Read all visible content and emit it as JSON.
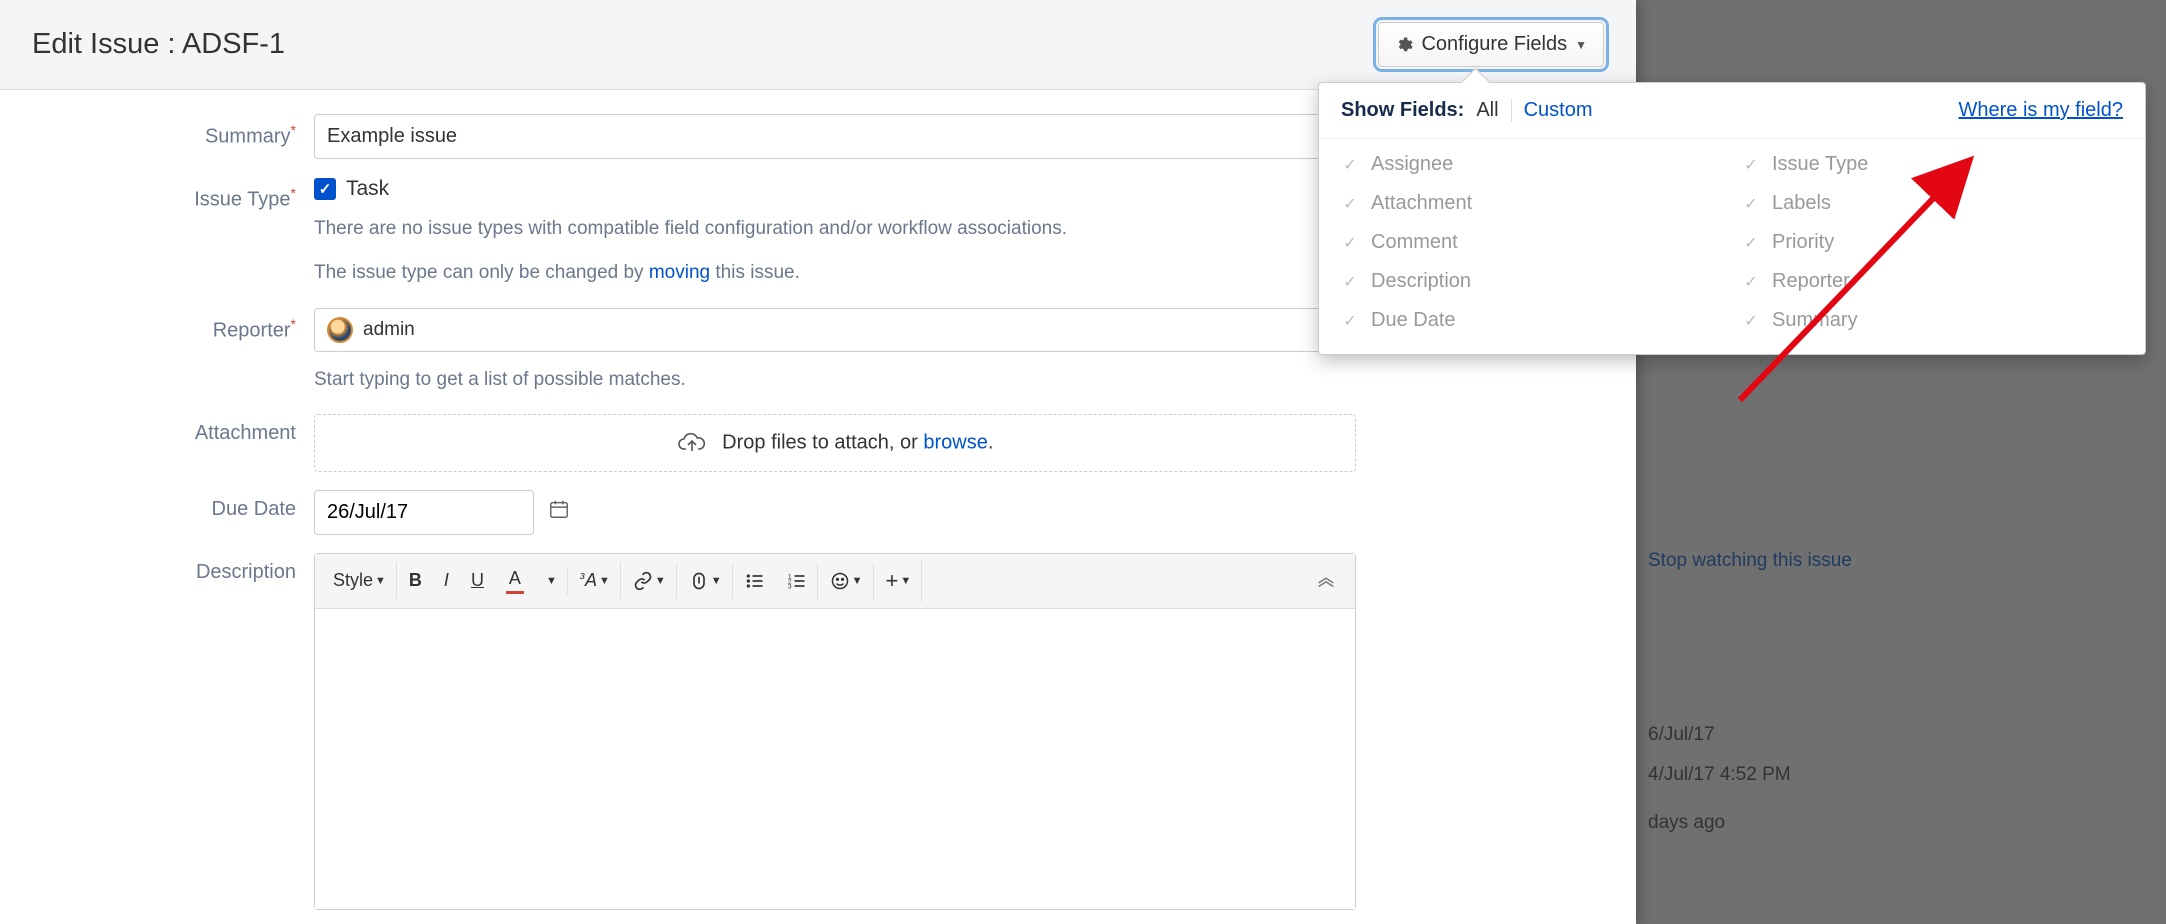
{
  "dialog": {
    "title": "Edit Issue : ADSF-1",
    "configure_button": "Configure Fields"
  },
  "form": {
    "summary": {
      "label": "Summary",
      "value": "Example issue"
    },
    "issue_type": {
      "label": "Issue Type",
      "value": "Task",
      "helper1": "There are no issue types with compatible field configuration and/or workflow associations.",
      "helper2_pre": "The issue type can only be changed by ",
      "helper2_link": "moving",
      "helper2_post": " this issue."
    },
    "reporter": {
      "label": "Reporter",
      "value": "admin",
      "helper": "Start typing to get a list of possible matches."
    },
    "attachment": {
      "label": "Attachment",
      "text_pre": "Drop files to attach, or ",
      "text_link": "browse",
      "text_post": "."
    },
    "due_date": {
      "label": "Due Date",
      "value": "26/Jul/17"
    },
    "description": {
      "label": "Description"
    }
  },
  "rte": {
    "style": "Style",
    "bold": "B",
    "italic": "I",
    "underline": "U",
    "color": "A",
    "clearfmt": "ᶾA"
  },
  "dropdown": {
    "show_fields": "Show Fields:",
    "all": "All",
    "custom": "Custom",
    "where": "Where is my field?",
    "col1": [
      "Assignee",
      "Attachment",
      "Comment",
      "Description",
      "Due Date"
    ],
    "col2": [
      "Issue Type",
      "Labels",
      "Priority",
      "Reporter",
      "Summary"
    ]
  },
  "behind": {
    "watch": "Stop watching this issue",
    "date1": "6/Jul/17",
    "date2": "4/Jul/17 4:52 PM",
    "date3": "days ago"
  }
}
